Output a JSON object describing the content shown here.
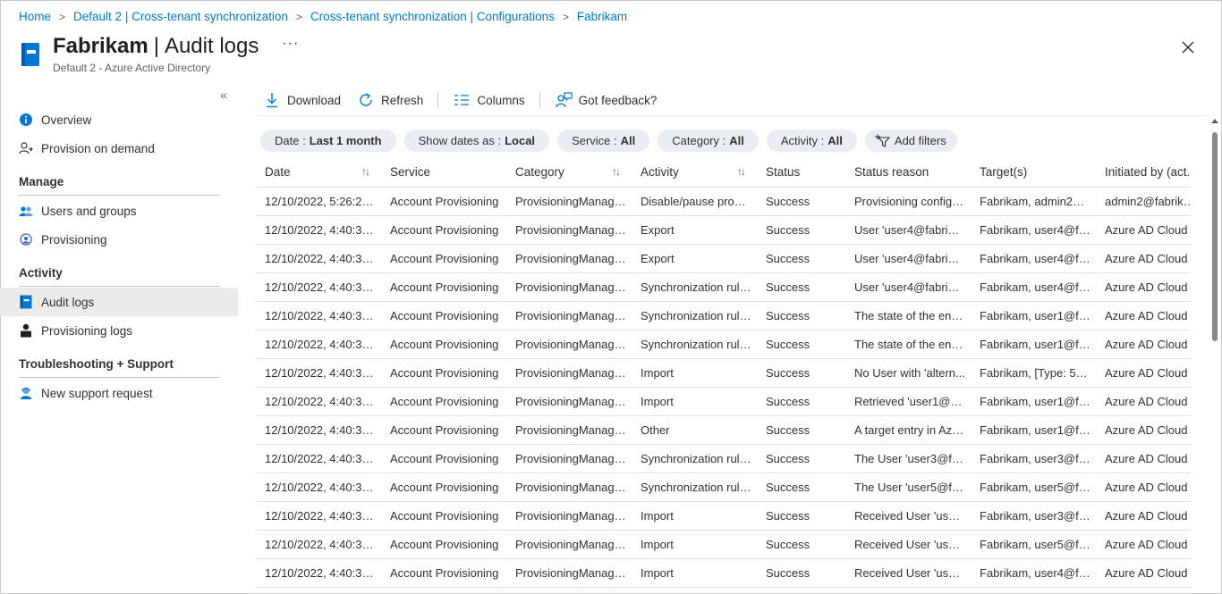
{
  "breadcrumb": {
    "items": [
      "Home",
      "Default 2 | Cross-tenant synchronization",
      "Cross-tenant synchronization | Configurations",
      "Fabrikam"
    ],
    "separator": ">"
  },
  "header": {
    "title_bold": "Fabrikam",
    "title_sep": "|",
    "title_rest": "Audit logs",
    "more": "···",
    "subtitle": "Default 2 - Azure Active Directory"
  },
  "sidebar": {
    "collapse": "«",
    "top_items": [
      {
        "label": "Overview",
        "icon": "info-icon"
      },
      {
        "label": "Provision on demand",
        "icon": "person-sync-icon"
      }
    ],
    "manage_title": "Manage",
    "manage_items": [
      {
        "label": "Users and groups",
        "icon": "users-icon"
      },
      {
        "label": "Provisioning",
        "icon": "provisioning-icon"
      }
    ],
    "activity_title": "Activity",
    "activity_items": [
      {
        "label": "Audit logs",
        "icon": "book-icon",
        "active": true
      },
      {
        "label": "Provisioning logs",
        "icon": "person-log-icon"
      }
    ],
    "troubleshoot_title": "Troubleshooting + Support",
    "troubleshoot_items": [
      {
        "label": "New support request",
        "icon": "support-person-icon"
      }
    ]
  },
  "toolbar": {
    "download": "Download",
    "refresh": "Refresh",
    "columns": "Columns",
    "feedback": "Got feedback?"
  },
  "filters": [
    {
      "key": "Date :",
      "value": "Last 1 month"
    },
    {
      "key": "Show dates as :",
      "value": "Local"
    },
    {
      "key": "Service :",
      "value": "All"
    },
    {
      "key": "Category :",
      "value": "All"
    },
    {
      "key": "Activity :",
      "value": "All"
    }
  ],
  "add_filters": "Add filters",
  "table": {
    "columns": [
      "Date",
      "Service",
      "Category",
      "Activity",
      "Status",
      "Status reason",
      "Target(s)",
      "Initiated by (act..."
    ],
    "rows": [
      [
        "12/10/2022, 5:26:25 ...",
        "Account Provisioning",
        "ProvisioningManage...",
        "Disable/pause provis...",
        "Success",
        "Provisioning configu...",
        "Fabrikam, admin2@f...",
        "admin2@fabrikam"
      ],
      [
        "12/10/2022, 4:40:37 ...",
        "Account Provisioning",
        "ProvisioningManage...",
        "Export",
        "Success",
        "User 'user4@fabrika...",
        "Fabrikam, user4@fab...",
        "Azure AD Cloud"
      ],
      [
        "12/10/2022, 4:40:37 ...",
        "Account Provisioning",
        "ProvisioningManage...",
        "Export",
        "Success",
        "User 'user4@fabrika...",
        "Fabrikam, user4@fab...",
        "Azure AD Cloud"
      ],
      [
        "12/10/2022, 4:40:34 ...",
        "Account Provisioning",
        "ProvisioningManage...",
        "Synchronization rule ...",
        "Success",
        "User 'user4@fabrika...",
        "Fabrikam, user4@fab...",
        "Azure AD Cloud"
      ],
      [
        "12/10/2022, 4:40:34 ...",
        "Account Provisioning",
        "ProvisioningManage...",
        "Synchronization rule ...",
        "Success",
        "The state of the entr...",
        "Fabrikam, user1@fab...",
        "Azure AD Cloud"
      ],
      [
        "12/10/2022, 4:40:34 ...",
        "Account Provisioning",
        "ProvisioningManage...",
        "Synchronization rule ...",
        "Success",
        "The state of the entr...",
        "Fabrikam, user1@fab...",
        "Azure AD Cloud"
      ],
      [
        "12/10/2022, 4:40:34 ...",
        "Account Provisioning",
        "ProvisioningManage...",
        "Import",
        "Success",
        "No User with 'altern...",
        "Fabrikam, [Type: 5, Id...",
        "Azure AD Cloud"
      ],
      [
        "12/10/2022, 4:40:34 ...",
        "Account Provisioning",
        "ProvisioningManage...",
        "Import",
        "Success",
        "Retrieved 'user1@fa...",
        "Fabrikam, user1@fab...",
        "Azure AD Cloud"
      ],
      [
        "12/10/2022, 4:40:34 ...",
        "Account Provisioning",
        "ProvisioningManage...",
        "Other",
        "Success",
        "A target entry in Azu...",
        "Fabrikam, user1@fab...",
        "Azure AD Cloud"
      ],
      [
        "12/10/2022, 4:40:33 ...",
        "Account Provisioning",
        "ProvisioningManage...",
        "Synchronization rule ...",
        "Success",
        "The User 'user3@fab...",
        "Fabrikam, user3@fab...",
        "Azure AD Cloud"
      ],
      [
        "12/10/2022, 4:40:33 ...",
        "Account Provisioning",
        "ProvisioningManage...",
        "Synchronization rule ...",
        "Success",
        "The User 'user5@fab...",
        "Fabrikam, user5@fab...",
        "Azure AD Cloud"
      ],
      [
        "12/10/2022, 4:40:33 ...",
        "Account Provisioning",
        "ProvisioningManage...",
        "Import",
        "Success",
        "Received User 'user3...",
        "Fabrikam, user3@fab...",
        "Azure AD Cloud"
      ],
      [
        "12/10/2022, 4:40:33 ...",
        "Account Provisioning",
        "ProvisioningManage...",
        "Import",
        "Success",
        "Received User 'user5...",
        "Fabrikam, user5@fab...",
        "Azure AD Cloud"
      ],
      [
        "12/10/2022, 4:40:33 ...",
        "Account Provisioning",
        "ProvisioningManage...",
        "Import",
        "Success",
        "Received User 'user4...",
        "Fabrikam, user4@fab...",
        "Azure AD Cloud"
      ]
    ]
  },
  "colors": {
    "link": "#0078d4",
    "pill_bg": "#e9eef5",
    "active_nav_bg": "#edebe9"
  }
}
